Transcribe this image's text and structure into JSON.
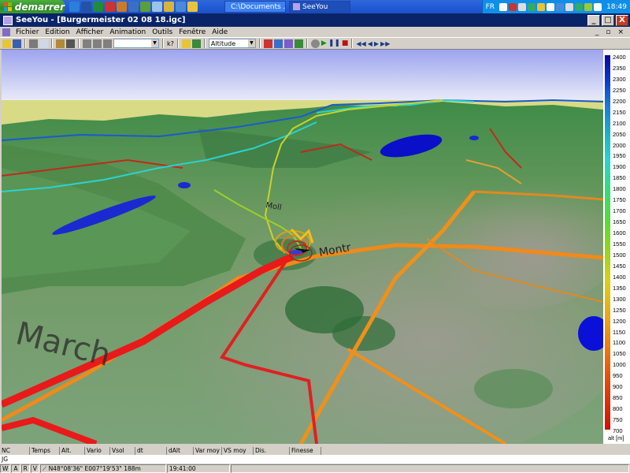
{
  "taskbar": {
    "start_label": "demarrer",
    "tasks": [
      {
        "label": "C:\\Documents ..."
      },
      {
        "label": "SeeYou"
      }
    ],
    "tray_lang": "FR",
    "clock": "18:49"
  },
  "window": {
    "title": "SeeYou - [Burgermeister 02 08 18.igc]",
    "minimize": "_",
    "maximize": "□",
    "close": "X"
  },
  "menu": {
    "items": [
      "Fichier",
      "Edition",
      "Afficher",
      "Animation",
      "Outils",
      "Fenêtre",
      "Aide"
    ],
    "mdi_controls": [
      "_",
      "▫",
      "×"
    ]
  },
  "toolbar": {
    "help_label": "k?",
    "altitude_value": "Altitude"
  },
  "map": {
    "labels": [
      "March",
      "Montr",
      "Moll"
    ]
  },
  "legend": {
    "ticks": [
      "2400",
      "2350",
      "2300",
      "2250",
      "2200",
      "2150",
      "2100",
      "2050",
      "2000",
      "1950",
      "1900",
      "1850",
      "1800",
      "1750",
      "1700",
      "1650",
      "1600",
      "1550",
      "1500",
      "1450",
      "1400",
      "1350",
      "1300",
      "1250",
      "1200",
      "1150",
      "1100",
      "1050",
      "1000",
      "950",
      "900",
      "850",
      "800",
      "750",
      "700"
    ],
    "unit": "alt [m]"
  },
  "data_columns": [
    "NC",
    "Temps",
    "Alt.",
    "Vario",
    "Vsol",
    "dt",
    "dAlt",
    "Var moy",
    "VS moy",
    "Dis. Parcou...",
    "Finesse"
  ],
  "data_row": "JG",
  "status": {
    "modes": [
      "W",
      "A",
      "R",
      "V"
    ],
    "position": "N48°08'36\" E007°19'53\" 188m",
    "time": "19:41:00"
  }
}
